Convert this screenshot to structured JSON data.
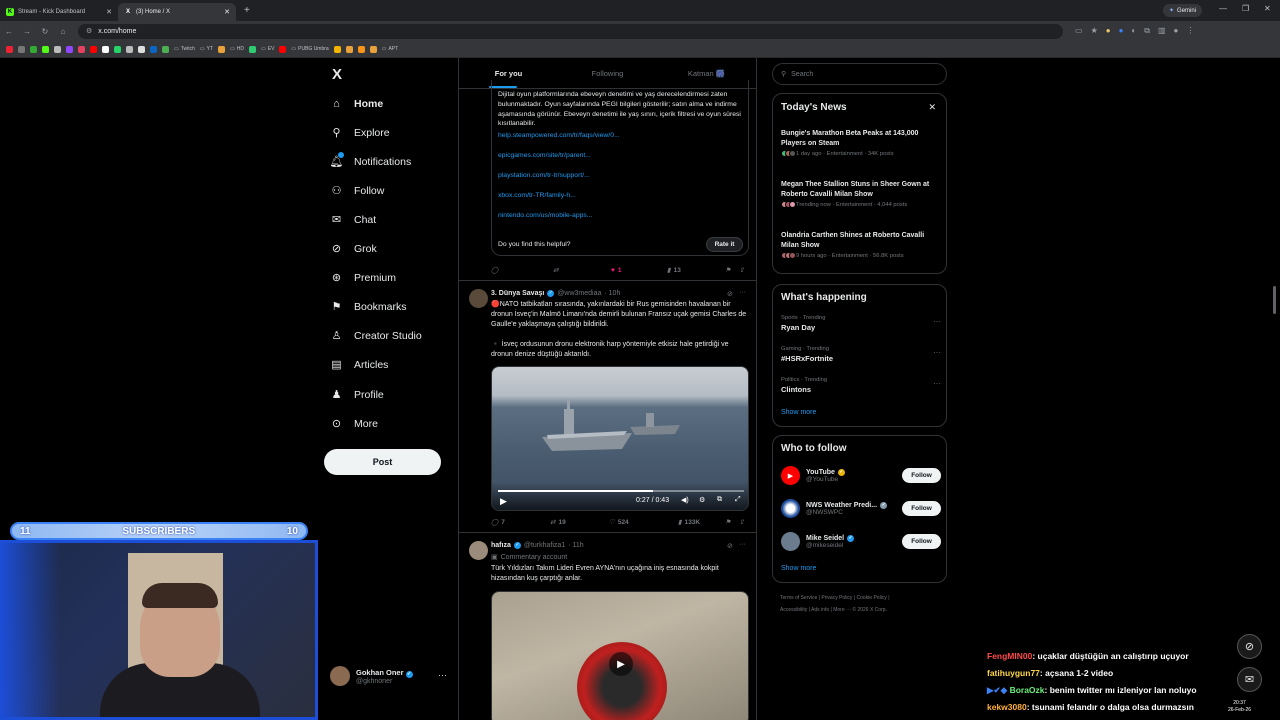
{
  "browser": {
    "tabs": [
      {
        "title": "Stream - Kick Dashboard",
        "icon": "kick-icon",
        "active": false
      },
      {
        "title": "(3) Home / X",
        "icon": "x-icon",
        "active": true
      }
    ],
    "gemini_label": "Gemini",
    "url": "x.com/home",
    "bookmarks": [
      "Twitch",
      "YT",
      "HD",
      "EV",
      "PUBG Umbra",
      "APT"
    ]
  },
  "nav": {
    "logo": "X",
    "items": [
      {
        "label": "Home",
        "icon": "home-icon"
      },
      {
        "label": "Explore",
        "icon": "search-icon"
      },
      {
        "label": "Notifications",
        "icon": "bell-icon"
      },
      {
        "label": "Follow",
        "icon": "person-plus-icon"
      },
      {
        "label": "Chat",
        "icon": "mail-icon"
      },
      {
        "label": "Grok",
        "icon": "grok-icon"
      },
      {
        "label": "Premium",
        "icon": "premium-icon"
      },
      {
        "label": "Bookmarks",
        "icon": "bookmark-icon"
      },
      {
        "label": "Creator Studio",
        "icon": "creator-studio-icon"
      },
      {
        "label": "Articles",
        "icon": "articles-icon"
      },
      {
        "label": "Profile",
        "icon": "profile-icon"
      },
      {
        "label": "More",
        "icon": "more-icon"
      }
    ],
    "post_button": "Post",
    "account": {
      "name": "Gokhan Oner",
      "handle": "@gkhnoner"
    }
  },
  "feed": {
    "tabs": [
      "For you",
      "Following",
      "Katman 🎆"
    ],
    "note": {
      "text": "Dijital oyun platformlarında ebeveyn denetimi ve yaş derecelendirmesi zaten bulunmaktadır. Oyun sayfalarında PEGI bilgileri gösterilir; satın alma ve indirme aşamasında görünür. Ebeveyn denetimi ile yaş sınırı, içerik filtresi ve oyun süresi kısıtlanabilir.",
      "links": [
        "help.steampowered.com/tr/faqs/view/0...",
        "epicgames.com/site/tr/parent...",
        "playstation.com/tr-tr/support/...",
        "xbox.com/tr-TR/family-h...",
        "nintendo.com/us/mobile-apps..."
      ],
      "helpful": "Do you find this helpful?",
      "rate": "Rate it"
    },
    "post0_actions": {
      "replies": "",
      "reposts": "",
      "likes": "1",
      "views": "13"
    },
    "post1": {
      "name": "3. Dünya Savaşı",
      "handle": "@ww3mediaa",
      "time": "· 10h",
      "text1": "🔴NATO tatbikatları sırasında, yakınlardaki bir Rus gemisinden havalanan bir dronun İsveç'in Malmö Limanı'nda demirli bulunan Fransız uçak gemisi Charles de Gaulle'e yaklaşmaya çalıştığı bildirildi.",
      "text2": "▪️ İsveç ordusunun dronu elektronik harp yöntemiyle etkisiz hale getirdiği ve dronun denize düştüğü aktarıldı.",
      "video_time": "0:27 / 0:43",
      "progress": 0.63,
      "replies": "7",
      "reposts": "19",
      "likes": "524",
      "views": "133K"
    },
    "post2": {
      "name": "hafıza",
      "handle": "@turkhafiza1",
      "time": "· 11h",
      "label": "Commentary account",
      "text": "Türk Yıldızları Takım Lideri Evren AYNA'nın uçağına iniş esnasında kokpit hizasından kuş çarptığı anlar."
    }
  },
  "right": {
    "search_placeholder": "Search",
    "news_title": "Today's News",
    "news": [
      {
        "headline": "Bungie's Marathon Beta Peaks at 143,000 Players on Steam",
        "meta": "1 day ago · Entertainment · 34K posts"
      },
      {
        "headline": "Megan Thee Stallion Stuns in Sheer Gown at Roberto Cavalli Milan Show",
        "meta": "Trending now · Entertainment · 4,044 posts"
      },
      {
        "headline": "Olandria Carthen Shines at Roberto Cavalli Milan Show",
        "meta": "9 hours ago · Entertainment · 56.8K posts"
      }
    ],
    "happening_title": "What's happening",
    "trends": [
      {
        "category": "Sports · Trending",
        "title": "Ryan Day"
      },
      {
        "category": "Gaming · Trending",
        "title": "#HSRxFortnite"
      },
      {
        "category": "Politics · Trending",
        "title": "Clintons"
      }
    ],
    "show_more": "Show more",
    "wtf_title": "Who to follow",
    "wtf": [
      {
        "name": "YouTube",
        "handle": "@YouTube"
      },
      {
        "name": "NWS Weather Predi...",
        "handle": "@NWSWPC"
      },
      {
        "name": "Mike Seidel",
        "handle": "@mikeseidel"
      }
    ],
    "follow_label": "Follow",
    "footer": [
      "Terms of Service",
      "Privacy Policy",
      "Cookie Policy",
      "Accessibility",
      "Ads info",
      "More ···",
      "© 2026 X Corp."
    ]
  },
  "overlay": {
    "subs_left": "11",
    "subs_label": "SUBSCRIBERS",
    "subs_right": "10",
    "chat": [
      {
        "user": "FengMIN00",
        "color": "#ff4b4b",
        "msg": ": uçaklar düştüğün an calıştırıp uçuyor"
      },
      {
        "user": "fatihuygun77",
        "color": "#ffd84a",
        "msg": ": açsana 1-2 video"
      },
      {
        "user": "BoraOzk",
        "color": "#6cf07a",
        "msg": ": benim twitter mı izleniyor lan noluyo"
      },
      {
        "user": "kekw3080",
        "color": "#ffb13b",
        "msg": ": tsunami felandır o dalga olsa durmazsın"
      }
    ],
    "clock_time": "20:37",
    "clock_date": "26-Feb-26"
  }
}
